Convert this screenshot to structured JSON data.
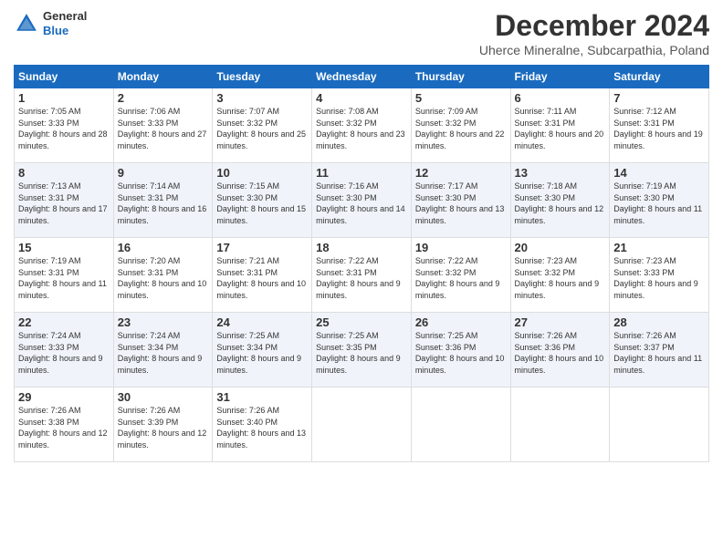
{
  "header": {
    "logo_general": "General",
    "logo_blue": "Blue",
    "month_title": "December 2024",
    "location": "Uherce Mineralne, Subcarpathia, Poland"
  },
  "weekdays": [
    "Sunday",
    "Monday",
    "Tuesday",
    "Wednesday",
    "Thursday",
    "Friday",
    "Saturday"
  ],
  "weeks": [
    [
      {
        "day": "1",
        "sunrise": "7:05 AM",
        "sunset": "3:33 PM",
        "daylight": "8 hours and 28 minutes."
      },
      {
        "day": "2",
        "sunrise": "7:06 AM",
        "sunset": "3:33 PM",
        "daylight": "8 hours and 27 minutes."
      },
      {
        "day": "3",
        "sunrise": "7:07 AM",
        "sunset": "3:32 PM",
        "daylight": "8 hours and 25 minutes."
      },
      {
        "day": "4",
        "sunrise": "7:08 AM",
        "sunset": "3:32 PM",
        "daylight": "8 hours and 23 minutes."
      },
      {
        "day": "5",
        "sunrise": "7:09 AM",
        "sunset": "3:32 PM",
        "daylight": "8 hours and 22 minutes."
      },
      {
        "day": "6",
        "sunrise": "7:11 AM",
        "sunset": "3:31 PM",
        "daylight": "8 hours and 20 minutes."
      },
      {
        "day": "7",
        "sunrise": "7:12 AM",
        "sunset": "3:31 PM",
        "daylight": "8 hours and 19 minutes."
      }
    ],
    [
      {
        "day": "8",
        "sunrise": "7:13 AM",
        "sunset": "3:31 PM",
        "daylight": "8 hours and 17 minutes."
      },
      {
        "day": "9",
        "sunrise": "7:14 AM",
        "sunset": "3:31 PM",
        "daylight": "8 hours and 16 minutes."
      },
      {
        "day": "10",
        "sunrise": "7:15 AM",
        "sunset": "3:30 PM",
        "daylight": "8 hours and 15 minutes."
      },
      {
        "day": "11",
        "sunrise": "7:16 AM",
        "sunset": "3:30 PM",
        "daylight": "8 hours and 14 minutes."
      },
      {
        "day": "12",
        "sunrise": "7:17 AM",
        "sunset": "3:30 PM",
        "daylight": "8 hours and 13 minutes."
      },
      {
        "day": "13",
        "sunrise": "7:18 AM",
        "sunset": "3:30 PM",
        "daylight": "8 hours and 12 minutes."
      },
      {
        "day": "14",
        "sunrise": "7:19 AM",
        "sunset": "3:30 PM",
        "daylight": "8 hours and 11 minutes."
      }
    ],
    [
      {
        "day": "15",
        "sunrise": "7:19 AM",
        "sunset": "3:31 PM",
        "daylight": "8 hours and 11 minutes."
      },
      {
        "day": "16",
        "sunrise": "7:20 AM",
        "sunset": "3:31 PM",
        "daylight": "8 hours and 10 minutes."
      },
      {
        "day": "17",
        "sunrise": "7:21 AM",
        "sunset": "3:31 PM",
        "daylight": "8 hours and 10 minutes."
      },
      {
        "day": "18",
        "sunrise": "7:22 AM",
        "sunset": "3:31 PM",
        "daylight": "8 hours and 9 minutes."
      },
      {
        "day": "19",
        "sunrise": "7:22 AM",
        "sunset": "3:32 PM",
        "daylight": "8 hours and 9 minutes."
      },
      {
        "day": "20",
        "sunrise": "7:23 AM",
        "sunset": "3:32 PM",
        "daylight": "8 hours and 9 minutes."
      },
      {
        "day": "21",
        "sunrise": "7:23 AM",
        "sunset": "3:33 PM",
        "daylight": "8 hours and 9 minutes."
      }
    ],
    [
      {
        "day": "22",
        "sunrise": "7:24 AM",
        "sunset": "3:33 PM",
        "daylight": "8 hours and 9 minutes."
      },
      {
        "day": "23",
        "sunrise": "7:24 AM",
        "sunset": "3:34 PM",
        "daylight": "8 hours and 9 minutes."
      },
      {
        "day": "24",
        "sunrise": "7:25 AM",
        "sunset": "3:34 PM",
        "daylight": "8 hours and 9 minutes."
      },
      {
        "day": "25",
        "sunrise": "7:25 AM",
        "sunset": "3:35 PM",
        "daylight": "8 hours and 9 minutes."
      },
      {
        "day": "26",
        "sunrise": "7:25 AM",
        "sunset": "3:36 PM",
        "daylight": "8 hours and 10 minutes."
      },
      {
        "day": "27",
        "sunrise": "7:26 AM",
        "sunset": "3:36 PM",
        "daylight": "8 hours and 10 minutes."
      },
      {
        "day": "28",
        "sunrise": "7:26 AM",
        "sunset": "3:37 PM",
        "daylight": "8 hours and 11 minutes."
      }
    ],
    [
      {
        "day": "29",
        "sunrise": "7:26 AM",
        "sunset": "3:38 PM",
        "daylight": "8 hours and 12 minutes."
      },
      {
        "day": "30",
        "sunrise": "7:26 AM",
        "sunset": "3:39 PM",
        "daylight": "8 hours and 12 minutes."
      },
      {
        "day": "31",
        "sunrise": "7:26 AM",
        "sunset": "3:40 PM",
        "daylight": "8 hours and 13 minutes."
      },
      null,
      null,
      null,
      null
    ]
  ]
}
